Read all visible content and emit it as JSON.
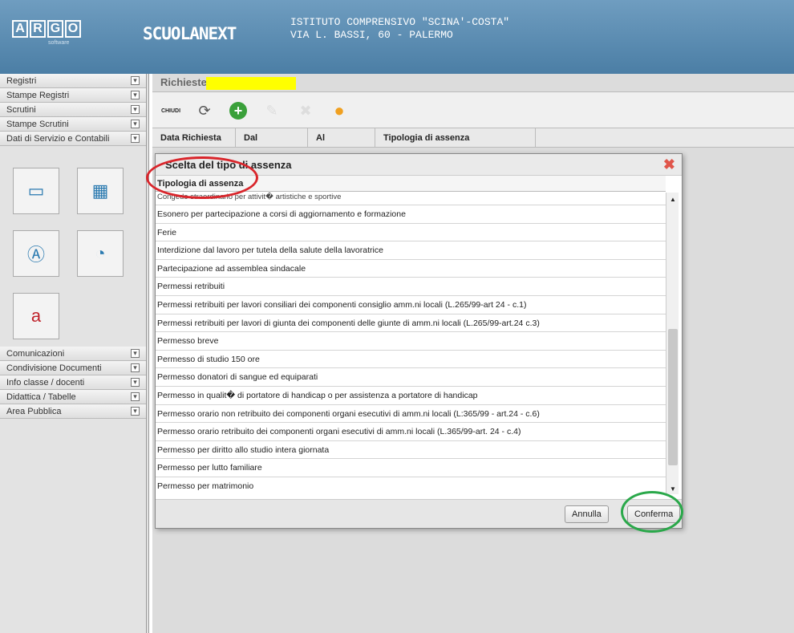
{
  "header": {
    "argo_letters": [
      "A",
      "R",
      "G",
      "O"
    ],
    "argo_sub": "software",
    "app_name": "SCUOLANEXT",
    "school_line1": "ISTITUTO COMPRENSIVO \"SCINA'-COSTA\"",
    "school_line2": "VIA L. BASSI, 60 - PALERMO"
  },
  "sidebar": {
    "top_items": [
      "Registri",
      "Stampe Registri",
      "Scrutini",
      "Stampe Scrutini",
      "Dati di Servizio e Contabili"
    ],
    "bottom_items": [
      "Comunicazioni",
      "Condivisione Documenti",
      "Info classe / docenti",
      "Didattica / Tabelle",
      "Area Pubblica"
    ],
    "toggle": "▾"
  },
  "main": {
    "title": "Richieste",
    "toolbar": {
      "close": "CHIUDI"
    },
    "columns": [
      "Data Richiesta",
      "Dal",
      "Al",
      "Tipologia di assenza"
    ]
  },
  "dialog": {
    "title": "Scelta del tipo di assenza",
    "close": "✖",
    "list_header": "Tipologia di assenza",
    "items": [
      "Congedo straordinario per attivit� artistiche e sportive",
      "Esonero per partecipazione a corsi di aggiornamento e formazione",
      "Ferie",
      "Interdizione dal lavoro per tutela della salute della lavoratrice",
      "Partecipazione ad assemblea sindacale",
      "Permessi retribuiti",
      "Permessi retribuiti per lavori consiliari dei componenti consiglio amm.ni locali (L.265/99-art 24 - c.1)",
      "Permessi retribuiti per lavori di giunta dei componenti delle giunte di amm.ni locali (L.265/99-art.24 c.3)",
      "Permesso breve",
      "Permesso di studio 150 ore",
      "Permesso donatori di sangue ed equiparati",
      "Permesso in qualit� di portatore di handicap o per assistenza a portatore di handicap",
      "Permesso orario non retribuito dei componenti organi esecutivi di amm.ni locali (L:365/99 - art.24 - c.6)",
      "Permesso orario retribuito dei componenti organi esecutivi di amm.ni locali (L.365/99-art. 24 - c.4)",
      "Permesso per diritto allo studio intera giornata",
      "Permesso per lutto familiare",
      "Permesso per matrimonio"
    ],
    "cancel": "Annulla",
    "confirm": "Conferma"
  },
  "colors": {
    "header": "#4b7ea5",
    "circle_red": "#d9252b",
    "circle_green": "#2aa84a"
  }
}
